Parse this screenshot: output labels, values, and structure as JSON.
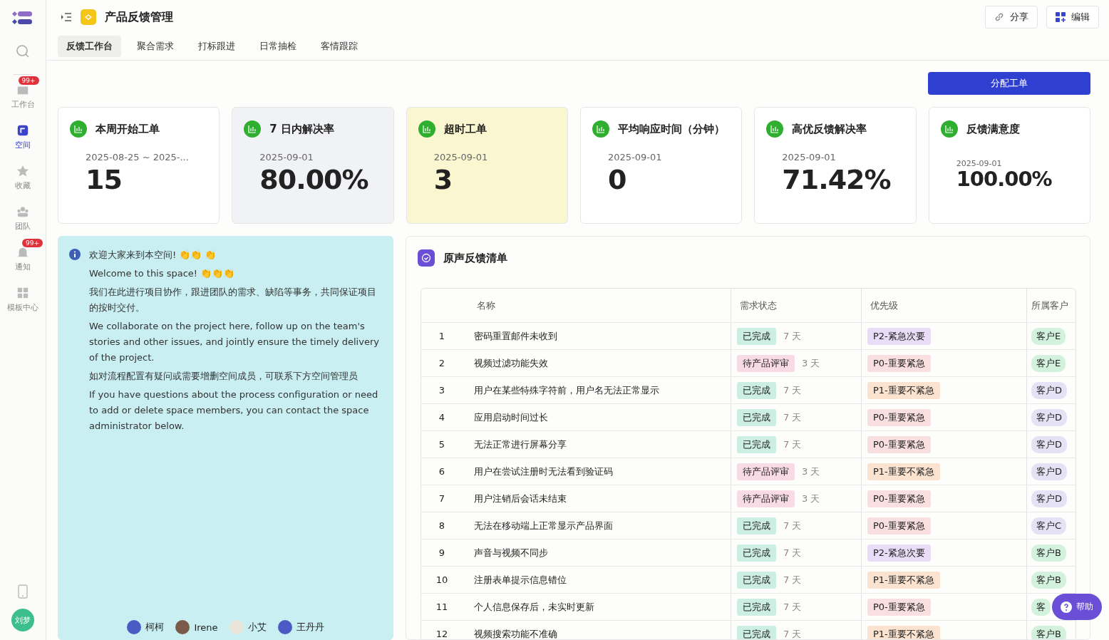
{
  "sidebar": {
    "items": [
      {
        "label": "工作台",
        "badge": "99+",
        "selected": false
      },
      {
        "label": "空间",
        "selected": true
      },
      {
        "label": "收藏",
        "selected": false
      },
      {
        "label": "团队",
        "selected": false
      },
      {
        "label": "通知",
        "badge": "99+",
        "selected": false
      },
      {
        "label": "模板中心",
        "selected": false
      }
    ],
    "avatar": "刘梦"
  },
  "header": {
    "title": "产品反馈管理",
    "actions": [
      {
        "label": "分享"
      },
      {
        "label": "编辑"
      }
    ]
  },
  "tabs": [
    {
      "label": "反馈工作台",
      "selected": true
    },
    {
      "label": "聚合需求",
      "selected": false
    },
    {
      "label": "打标跟进",
      "selected": false
    },
    {
      "label": "日常抽检",
      "selected": false
    },
    {
      "label": "客情跟踪",
      "selected": false
    }
  ],
  "primary_button": "分配工单",
  "stats": [
    {
      "title": "本周开始工单",
      "date": "2025-08-25 ~ 2025-...",
      "value": "15",
      "color": "#ffffff",
      "compact": false
    },
    {
      "title": "7 日内解决率",
      "date": "2025-09-01",
      "value": "80.00%",
      "color": "#f1f2f5",
      "compact": false
    },
    {
      "title": "超时工单",
      "date": "2025-09-01",
      "value": "3",
      "color": "#faf6cf",
      "compact": false
    },
    {
      "title": "平均响应时间（分钟）",
      "date": "2025-09-01",
      "value": "0",
      "color": "#ffffff",
      "compact": false
    },
    {
      "title": "高优反馈解决率",
      "date": "2025-09-01",
      "value": "71.42%",
      "color": "#ffffff",
      "compact": false
    },
    {
      "title": "反馈满意度",
      "date": "2025-09-01",
      "value": "100.00%",
      "color": "#ffffff",
      "compact": true
    }
  ],
  "notice": {
    "paragraphs": [
      "欢迎大家来到本空间! 👏👏 👏",
      "Welcome to this space! 👏👏👏",
      "我们在此进行项目协作，跟进团队的需求、缺陷等事务，共同保证项目的按时交付。",
      "We collaborate on the project here, follow up on the team's stories and other issues, and jointly ensure the timely delivery of the project.",
      "如对流程配置有疑问或需要增删空间成员，可联系下方空间管理员",
      "If you have questions about the process configuration or need to add or delete space members, you can contact the space administrator below."
    ],
    "admins": [
      {
        "name": "柯柯",
        "color": "#4a5bc4"
      },
      {
        "name": "Irene",
        "color": "#7a5a48"
      },
      {
        "name": "小艾",
        "color": "#e8e4da"
      },
      {
        "name": "王丹丹",
        "color": "#4a5bc4"
      }
    ]
  },
  "feedback_list": {
    "title": "原声反馈清单",
    "columns": [
      "名称",
      "需求状态",
      "优先级",
      "所属客户"
    ],
    "rows": [
      {
        "index": "1",
        "name": "密码重置邮件未收到",
        "status": {
          "label": "已完成",
          "color": "#cdeee2"
        },
        "days": "7 天",
        "priority": {
          "label": "P2-紧急次要",
          "color": "#e8dcf7"
        },
        "customer": {
          "label": "客户E",
          "color": "#d3f2dd"
        }
      },
      {
        "index": "2",
        "name": "视频过滤功能失效",
        "status": {
          "label": "待产品评审",
          "color": "#f8dbe4"
        },
        "days": "3 天",
        "priority": {
          "label": "P0-重要紧急",
          "color": "#fadfe0"
        },
        "customer": {
          "label": "客户E",
          "color": "#d3f2dd"
        }
      },
      {
        "index": "3",
        "name": "用户在某些特殊字符前，用户名无法正常显示",
        "status": {
          "label": "已完成",
          "color": "#cdeee2"
        },
        "days": "7 天",
        "priority": {
          "label": "P1-重要不紧急",
          "color": "#fbe3d0"
        },
        "customer": {
          "label": "客户D",
          "color": "#e6e2f5"
        }
      },
      {
        "index": "4",
        "name": "应用启动时间过长",
        "status": {
          "label": "已完成",
          "color": "#cdeee2"
        },
        "days": "7 天",
        "priority": {
          "label": "P0-重要紧急",
          "color": "#fadfe0"
        },
        "customer": {
          "label": "客户D",
          "color": "#e6e2f5"
        }
      },
      {
        "index": "5",
        "name": "无法正常进行屏幕分享",
        "status": {
          "label": "已完成",
          "color": "#cdeee2"
        },
        "days": "7 天",
        "priority": {
          "label": "P0-重要紧急",
          "color": "#fadfe0"
        },
        "customer": {
          "label": "客户D",
          "color": "#e6e2f5"
        }
      },
      {
        "index": "6",
        "name": "用户在尝试注册时无法看到验证码",
        "status": {
          "label": "待产品评审",
          "color": "#f8dbe4"
        },
        "days": "3 天",
        "priority": {
          "label": "P1-重要不紧急",
          "color": "#fbe3d0"
        },
        "customer": {
          "label": "客户D",
          "color": "#e6e2f5"
        }
      },
      {
        "index": "7",
        "name": "用户注销后会话未结束",
        "status": {
          "label": "待产品评审",
          "color": "#f8dbe4"
        },
        "days": "3 天",
        "priority": {
          "label": "P0-重要紧急",
          "color": "#fadfe0"
        },
        "customer": {
          "label": "客户D",
          "color": "#e6e2f5"
        }
      },
      {
        "index": "8",
        "name": "无法在移动端上正常显示产品界面",
        "status": {
          "label": "已完成",
          "color": "#cdeee2"
        },
        "days": "7 天",
        "priority": {
          "label": "P0-重要紧急",
          "color": "#fadfe0"
        },
        "customer": {
          "label": "客户C",
          "color": "#e6e2f5"
        }
      },
      {
        "index": "9",
        "name": "声音与视频不同步",
        "status": {
          "label": "已完成",
          "color": "#cdeee2"
        },
        "days": "7 天",
        "priority": {
          "label": "P2-紧急次要",
          "color": "#e8dcf7"
        },
        "customer": {
          "label": "客户B",
          "color": "#d3f2dd"
        }
      },
      {
        "index": "10",
        "name": "注册表单提示信息错位",
        "status": {
          "label": "已完成",
          "color": "#cdeee2"
        },
        "days": "7 天",
        "priority": {
          "label": "P1-重要不紧急",
          "color": "#fbe3d0"
        },
        "customer": {
          "label": "客户B",
          "color": "#d3f2dd"
        }
      },
      {
        "index": "11",
        "name": "个人信息保存后，未实时更新",
        "status": {
          "label": "已完成",
          "color": "#cdeee2"
        },
        "days": "7 天",
        "priority": {
          "label": "P0-重要紧急",
          "color": "#fadfe0"
        },
        "customer": {
          "label": "客",
          "color": "#d3f2dd"
        }
      },
      {
        "index": "12",
        "name": "视频搜索功能不准确",
        "status": {
          "label": "已完成",
          "color": "#cdeee2"
        },
        "days": "7 天",
        "priority": {
          "label": "P1-重要不紧急",
          "color": "#fbe3d0"
        },
        "customer": {
          "label": "客户B",
          "color": "#d3f2dd"
        }
      }
    ]
  },
  "help_button": "帮助"
}
